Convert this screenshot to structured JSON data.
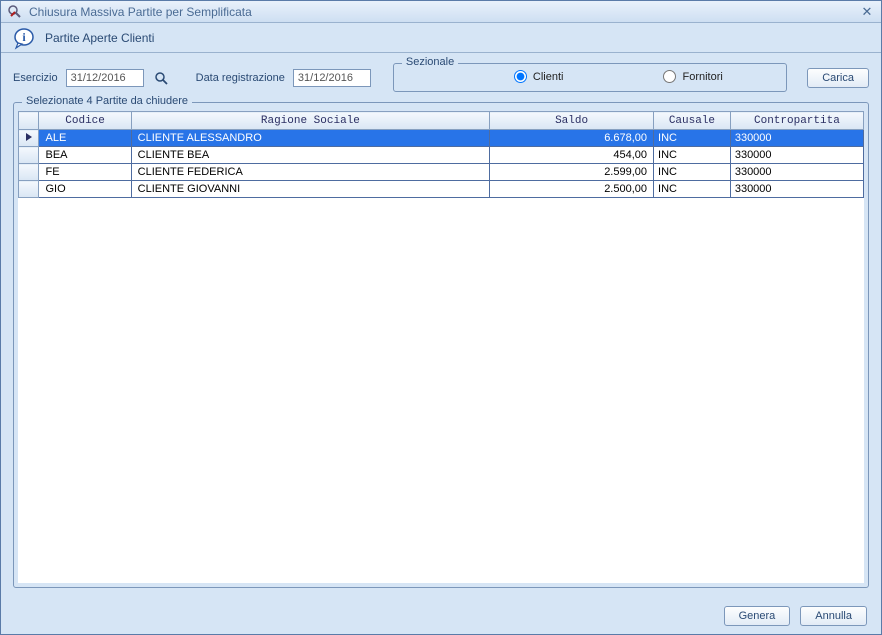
{
  "window": {
    "title": "Chiusura Massiva Partite per Semplificata",
    "subtitle": "Partite Aperte Clienti"
  },
  "toolbar": {
    "esercizio_label": "Esercizio",
    "esercizio_value": "31/12/2016",
    "data_reg_label": "Data registrazione",
    "data_reg_value": "31/12/2016",
    "sezionale_label": "Sezionale",
    "radio_clienti": "Clienti",
    "radio_fornitori": "Fornitori",
    "carica_label": "Carica"
  },
  "table": {
    "legend": "Selezionate 4 Partite da chiudere",
    "headers": {
      "codice": "Codice",
      "ragione": "Ragione Sociale",
      "saldo": "Saldo",
      "causale": "Causale",
      "contro": "Contropartita"
    },
    "rows": [
      {
        "codice": "ALE",
        "ragione": "CLIENTE ALESSANDRO",
        "saldo": "6.678,00",
        "causale": "INC",
        "contro": "330000",
        "selected": true
      },
      {
        "codice": "BEA",
        "ragione": "CLIENTE BEA",
        "saldo": "454,00",
        "causale": "INC",
        "contro": "330000",
        "selected": false
      },
      {
        "codice": "FE",
        "ragione": "CLIENTE FEDERICA",
        "saldo": "2.599,00",
        "causale": "INC",
        "contro": "330000",
        "selected": false
      },
      {
        "codice": "GIO",
        "ragione": "CLIENTE GIOVANNI",
        "saldo": "2.500,00",
        "causale": "INC",
        "contro": "330000",
        "selected": false
      }
    ]
  },
  "footer": {
    "genera": "Genera",
    "annulla": "Annulla"
  }
}
